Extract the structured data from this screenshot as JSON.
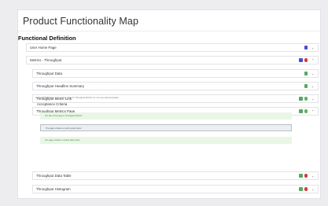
{
  "page": {
    "title": "Product Functionality Map",
    "section_title": "Functional Definition"
  },
  "rows": {
    "user_home": {
      "label": "User Home Page",
      "chevron": "⌄"
    },
    "metrics_throughput": {
      "label": "Metrics - Throughput",
      "chevron": "⌃"
    },
    "throughput_data": {
      "label": "Throughput Data",
      "chevron": "⌄"
    },
    "headline_summary": {
      "label": "Throughput Headline Summary",
      "chevron": "⌄"
    },
    "metric_link": {
      "label": "Throughput Metric Link",
      "chevron": "⌄"
    },
    "metrics_page": {
      "label": "Throughput Metrics Page",
      "chevron": "⌃"
    },
    "data_table": {
      "label": "Throughput Data Table",
      "chevron": "⌄"
    },
    "histogram": {
      "label": "Throughput Histogram",
      "chevron": "⌄"
    }
  },
  "metrics_page_detail": {
    "story": "As an ART RAF Rev I want a metric page for 'Throughput Metrics' for I can see data and graphs",
    "acceptance_title": "Acceptance Criteria",
    "chevron": "⌃",
    "criteria": [
      {
        "text": "The title of the page is 'Throughput Metrics'",
        "state": "green"
      },
      {
        "text": "The page contains a metrics graph panel",
        "state": "gray"
      },
      {
        "text": "The page contains a metrics table panel",
        "state": "green"
      }
    ]
  },
  "icons": {
    "blue_badge": "blue-square-icon",
    "green_badge": "green-square-icon",
    "red_dot": "red-circle-icon",
    "green_dot": "green-circle-icon"
  },
  "colors": {
    "blue": "#4a4ad1",
    "green": "#56a860",
    "red": "#d23b3b",
    "criteria_green_bg": "#e9f6e6",
    "criteria_gray_bg": "#eceff1"
  }
}
